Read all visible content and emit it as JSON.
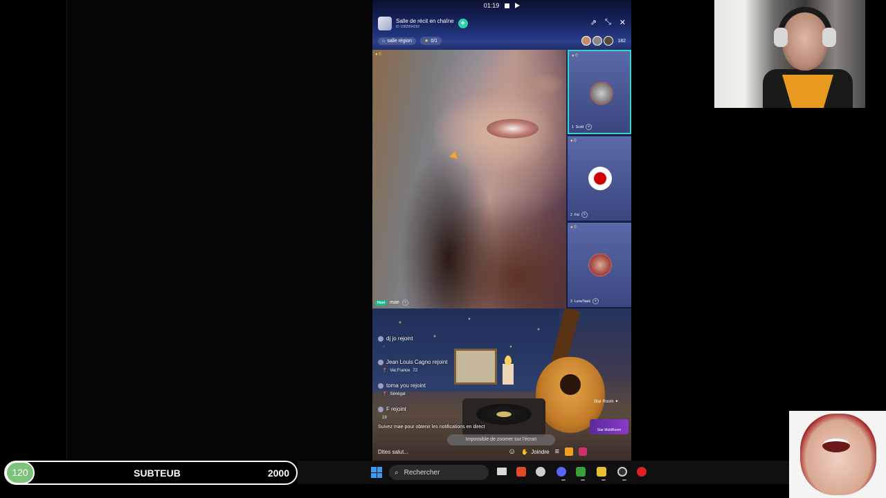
{
  "status_bar": {
    "time": "01:19"
  },
  "room": {
    "title": "Salle de récit en chaîne",
    "id": "ID 1082994292",
    "region_chip": "salle région",
    "seats_chip": "0/1",
    "viewer_count": "182"
  },
  "host": {
    "tag": "Host",
    "name": "mae"
  },
  "seats": [
    {
      "index": "1",
      "name": "Scott",
      "coin": "0"
    },
    {
      "index": "2",
      "name": "Fst",
      "coin": "0"
    },
    {
      "index": "3",
      "name": "LunaTiaek",
      "coin": "0"
    }
  ],
  "main_coin": "0",
  "chat": [
    {
      "text": "dj jo rejoint",
      "sub": ""
    },
    {
      "text": "Jean Louis Cagno rejoint",
      "sub": "Var,France",
      "extra": "72"
    },
    {
      "text": "toma you rejoint",
      "sub": "Sénégal"
    },
    {
      "text": "F rejoint",
      "sub": "",
      "extra": "19"
    }
  ],
  "follow_notice": "Suivez mae pour obtenir les notifications en direct",
  "toast": "Impossible de zoomer sur l'écran",
  "star_room": "Star Room",
  "star_multiroom": "Star MultiRoom",
  "input": {
    "placeholder": "Dites salut...",
    "join_label": "Joindre"
  },
  "score": {
    "badge": "120",
    "name": "SUBTEUB",
    "goal": "2000"
  },
  "taskbar": {
    "search_label": "Rechercher"
  },
  "colors": {
    "accent": "#2fd0a8",
    "active_seat": "#35d6c8",
    "badge": "#7cc27a",
    "windows_blue": "#3a9cf0"
  }
}
